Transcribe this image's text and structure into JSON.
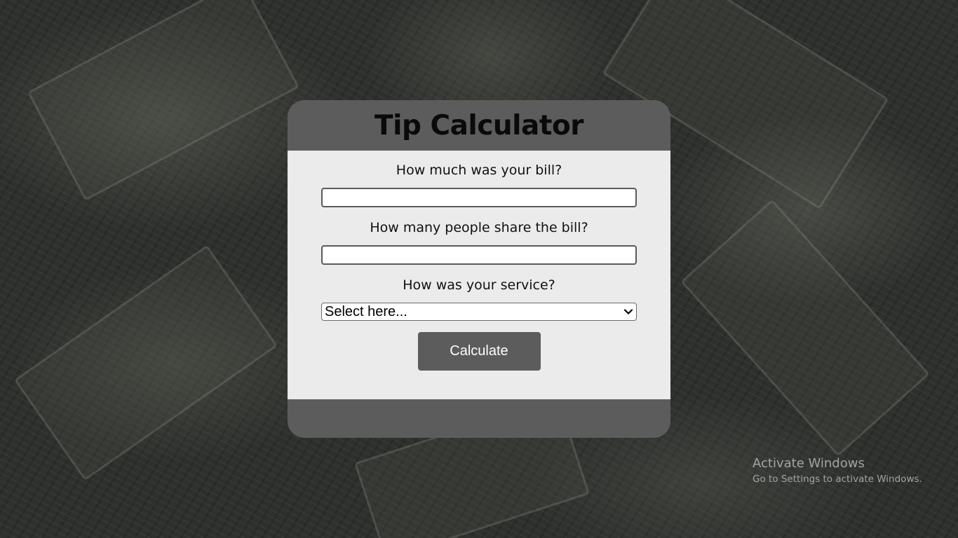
{
  "app": {
    "title": "Tip Calculator"
  },
  "form": {
    "bill_question": "How much was your bill?",
    "bill_value": "",
    "people_question": "How many people share the bill?",
    "people_value": "",
    "service_question": "How was your service?",
    "service_selected": "Select here...",
    "calculate_label": "Calculate"
  },
  "watermark": {
    "title": "Activate Windows",
    "subtitle": "Go to Settings to activate Windows."
  },
  "colors": {
    "card_header": "#5c5c5c",
    "card_body": "#ebebeb",
    "button": "#5c5c5c",
    "button_text": "#ffffff"
  },
  "icons": {
    "select_arrow": "chevron-down-icon"
  }
}
